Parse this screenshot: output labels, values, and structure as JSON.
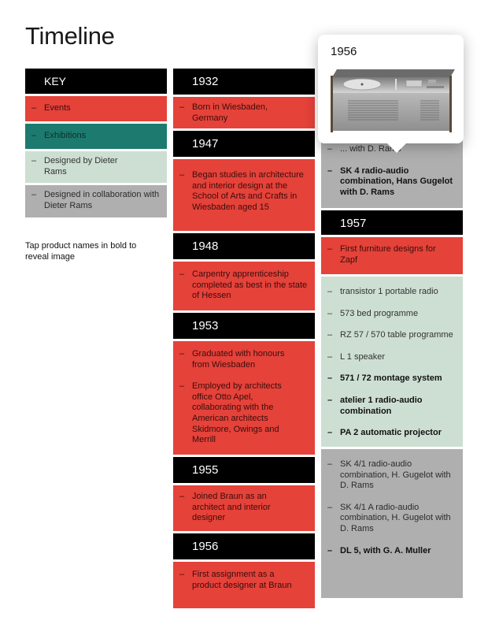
{
  "page": {
    "title": "Timeline"
  },
  "key": {
    "heading": "KEY",
    "dash": "–",
    "items": [
      {
        "label": "Events",
        "category": "events"
      },
      {
        "label": "Exhibitions",
        "category": "exhibitions"
      },
      {
        "label": "Designed by Dieter Rams",
        "category": "designed-by"
      },
      {
        "label": "Designed in collaboration with Dieter Rams",
        "category": "collaboration"
      }
    ],
    "colors": {
      "events": "#e5423a",
      "exhibitions": "#1c7b6e",
      "designed_by": "#cddfd3",
      "collaboration": "#afafaf",
      "year_header": "#000000"
    }
  },
  "hint": {
    "text": "Tap product names in bold to reveal image"
  },
  "timeline": {
    "y1932": {
      "year": "1932",
      "events": [
        "Born in Wiesbaden, Germany"
      ]
    },
    "y1947": {
      "year": "1947",
      "events": [
        "Began studies in architecture and interior design at the School of Arts  and Crafts in Wiesbaden aged 15"
      ]
    },
    "y1948": {
      "year": "1948",
      "events": [
        "Carpentry apprenticeship completed as best in the state of Hessen"
      ]
    },
    "y1953": {
      "year": "1953",
      "events": [
        "Graduated with honours from Wiesbaden",
        "Employed by architects office Otto Apel, collaborating with the American architects Skidmore, Owings and Merrill"
      ]
    },
    "y1955": {
      "year": "1955",
      "events": [
        "Joined Braun as an architect and interior designer"
      ]
    },
    "y1956": {
      "year": "1956",
      "events": [
        "First assignment as a product designer at Braun"
      ],
      "collaboration": [
        {
          "text": "... with D. Rams",
          "bold": false
        },
        {
          "text": "SK 4 radio-audio combination, Hans Gugelot with D. Rams",
          "bold": true
        }
      ]
    },
    "y1957": {
      "year": "1957",
      "events": [
        "First furniture designs for Zapf"
      ],
      "designed_by": [
        {
          "text": "transistor 1 portable radio",
          "bold": false
        },
        {
          "text": "573 bed programme",
          "bold": false
        },
        {
          "text": "RZ 57 / 570 table programme",
          "bold": false
        },
        {
          "text": "L 1 speaker",
          "bold": false
        },
        {
          "text": "571 / 72 montage system",
          "bold": true
        },
        {
          "text": "atelier 1 radio-audio combination",
          "bold": true
        },
        {
          "text": "PA 2 automatic projector",
          "bold": true
        }
      ],
      "collaboration": [
        {
          "text": "SK 4/1 radio-audio combination, H. Gugelot with D. Rams",
          "bold": false
        },
        {
          "text": "SK 4/1 A radio-audio combination, H. Gugelot with  D. Rams",
          "bold": false
        },
        {
          "text": "DL 5, with G. A. Muller",
          "bold": true
        }
      ]
    }
  },
  "popup": {
    "year": "1956",
    "image_alt": "SK 4 radio-audio combination",
    "icon": "record-player-image"
  }
}
